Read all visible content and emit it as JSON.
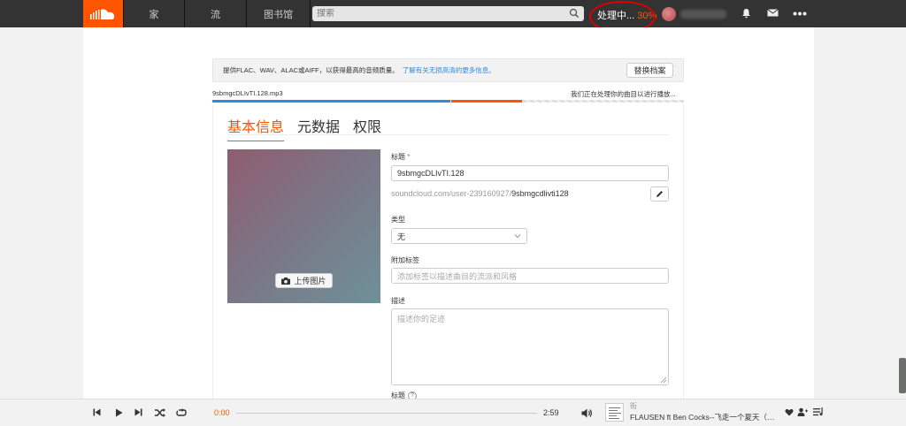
{
  "nav": {
    "home": "家",
    "stream": "流",
    "library": "图书馆",
    "search_placeholder": "搜索",
    "processing_label": "处理中...",
    "processing_pct": "30%"
  },
  "notice": {
    "text": "提供FLAC、WAV、ALAC或AIFF，以获得最高的音频质量。",
    "link": "了解有关无损高清的更多信息。",
    "replace_button": "替换档案"
  },
  "upload": {
    "filename": "9sbmgcDLIvTI.128.mp3",
    "progress_message": "我们正在处理你的曲目以进行播放...",
    "uploaded_fraction": 0.504,
    "processed_fraction": 0.15
  },
  "tabs": [
    {
      "label": "基本信息",
      "active": true
    },
    {
      "label": "元数据",
      "active": false
    },
    {
      "label": "权限",
      "active": false
    }
  ],
  "form": {
    "upload_image": "上传图片",
    "title_label": "标题",
    "required_mark": "*",
    "title_value": "9sbmgcDLIvTI.128",
    "url_prefix": "soundcloud.com/user-239160927/",
    "url_slug": "9sbmgcdlivti128",
    "genre_label": "类型",
    "genre_value": "无",
    "tags_label": "附加标签",
    "tags_placeholder": "添加标签以描述曲目的流派和风格",
    "description_label": "描述",
    "description_placeholder": "描述你的足迹",
    "caption_label": "标题"
  },
  "player": {
    "current_time": "0:00",
    "duration": "2:59",
    "artist": "街",
    "title": "FLAUSEN ft Ben Cocks--飞走一个夏天（Ac..."
  },
  "colors": {
    "accent": "#ff5500",
    "topbar": "#333333",
    "link": "#3388dd",
    "annotation_ring": "#dd0000"
  }
}
